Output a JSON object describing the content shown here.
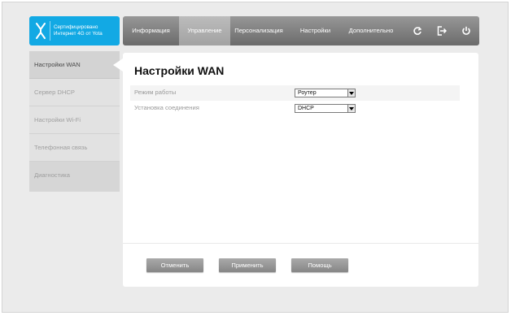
{
  "logo": {
    "line1": "Сертифицировано",
    "line2": "Интернет 4G от Yota",
    "color": "#12a9e4"
  },
  "topnav": {
    "items": [
      {
        "label": "Информация",
        "active": false
      },
      {
        "label": "Управление",
        "active": true
      },
      {
        "label": "Персонализация",
        "active": false
      },
      {
        "label": "Настройки",
        "active": false
      },
      {
        "label": "Дополнительно",
        "active": false
      }
    ],
    "icons": [
      "refresh-icon",
      "logout-icon",
      "power-icon"
    ]
  },
  "sidebar": {
    "items": [
      {
        "label": "Настройки WAN",
        "active": true
      },
      {
        "label": "Сервер DHCP",
        "active": false
      },
      {
        "label": "Настройки Wi-Fi",
        "active": false
      },
      {
        "label": "Телефонная связь",
        "active": false
      },
      {
        "label": "Диагностика",
        "active": false
      }
    ]
  },
  "main": {
    "title": "Настройки WAN",
    "fields": [
      {
        "label": "Режим работы",
        "value": "Роутер"
      },
      {
        "label": "Установка соединения",
        "value": "DHCP"
      }
    ]
  },
  "buttons": {
    "cancel": "Отменить",
    "apply": "Применить",
    "help": "Помощь"
  }
}
